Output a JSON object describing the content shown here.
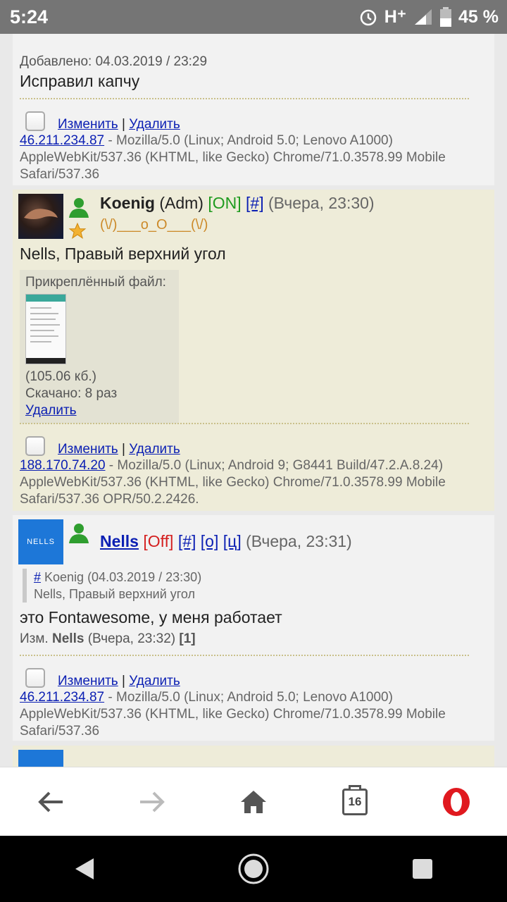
{
  "status_bar": {
    "time": "5:24",
    "network": "H⁺",
    "battery": "45 %"
  },
  "post1": {
    "added_label": "Добавлено: 04.03.2019 / 23:29",
    "text": "Исправил капчу",
    "edit": "Изменить",
    "sep": "|",
    "delete": "Удалить",
    "ip": "46.211.234.87",
    "ua": " - Mozilla/5.0 (Linux; Android 5.0; Lenovo A1000) AppleWebKit/537.36 (KHTML, like Gecko) Chrome/71.0.3578.99 Mobile Safari/537.36"
  },
  "post2": {
    "username": "Koenig",
    "role": "(Adm)",
    "status": "[ON]",
    "anchor": "[#]",
    "time": "(Вчера, 23:30)",
    "signature": "(\\/)___o_O___(\\/)",
    "text": "Nells, Правый верхний угол",
    "attachment": {
      "label": "Прикреплённый файл:",
      "size": "(105.06 кб.)",
      "downloads": "Скачано: 8 раз",
      "delete": "Удалить"
    },
    "edit": "Изменить",
    "sep": "|",
    "delete": "Удалить",
    "ip": "188.170.74.20",
    "ua": " - Mozilla/5.0 (Linux; Android 9; G8441 Build/47.2.A.8.24) AppleWebKit/537.36 (KHTML, like Gecko) Chrome/71.0.3578.99 Mobile Safari/537.36 OPR/50.2.2426."
  },
  "post3": {
    "avatar_text": "NELLS",
    "username": "Nells",
    "status": "[Off]",
    "anchor": "[#]",
    "reply": "[о]",
    "quote_btn": "[ц]",
    "time": "(Вчера, 23:31)",
    "quote": {
      "anchor": "#",
      "author": " Koenig (04.03.2019 / 23:30)",
      "text": "Nells, Правый верхний угол"
    },
    "text": "это Fontawesome, у меня работает",
    "edited_prefix": "Изм.",
    "edited_by": "Nells",
    "edited_time": "(Вчера, 23:32)",
    "edited_count": "[1]",
    "edit": "Изменить",
    "sep": "|",
    "delete": "Удалить",
    "ip": "46.211.234.87",
    "ua": " - Mozilla/5.0 (Linux; Android 5.0; Lenovo A1000) AppleWebKit/537.36 (KHTML, like Gecko) Chrome/71.0.3578.99 Mobile Safari/537.36"
  },
  "browser_toolbar": {
    "tabs_count": "16"
  },
  "colors": {
    "accent_link": "#0b1fb3",
    "online": "#1f9b1f",
    "offline": "#d42020",
    "opera_red": "#e0191f"
  }
}
